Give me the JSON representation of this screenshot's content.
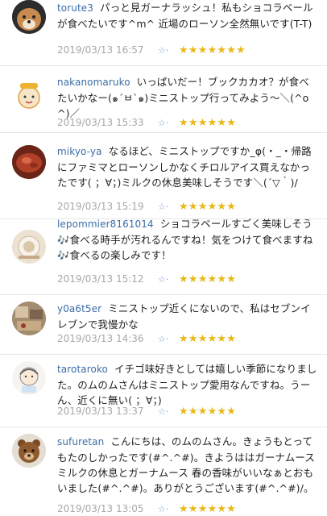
{
  "comments": [
    {
      "user": "torute3",
      "text": "パっと見ガーナラッシュ！私もショコラベールが食べたいです^m^ 近場のローソン全然無いです(T-T)",
      "date": "2019/03/13 16:57",
      "stars": "★★★★★★★",
      "mini_star": "☆·"
    },
    {
      "user": "nakanomaruko",
      "text": "いっぱいだー！ブックカカオ？が食べたいかなー(๑´ㅂ`๑)ミニストップ行ってみよう〜＼(^o^)／",
      "date": "2019/03/13 15:33",
      "stars": "★★★★★★",
      "mini_star": "☆·"
    },
    {
      "user": "mikyo-ya",
      "text": "なるほど、ミニストップですか_φ(・_・帰路にファミマとローソンしかなくチロルアイス買えなかったです( ；∀；)ミルクの休息美味しそうです＼(´▽｀)/",
      "date": "2019/03/13 15:19",
      "stars": "★★★★★★",
      "mini_star": "☆·"
    },
    {
      "user": "lepommier8161014",
      "text": "ショコラベールすごく美味しそう🎶食べる時手が汚れるんですね！気をつけて食べますね🎶食べるの楽しみです！",
      "date": "2019/03/13 15:12",
      "stars": "★★★★★★",
      "mini_star": "☆·"
    },
    {
      "user": "y0a6t5er",
      "text": "ミニストップ近くにないので、私はセブンイレブンで我慢かな",
      "date": "2019/03/13 14:36",
      "stars": "★★★★★★",
      "mini_star": "☆·"
    },
    {
      "user": "tarotaroko",
      "text": "イチゴ味好きとしては嬉しい季節になりました。のムのムさんはミニストップ愛用なんですね。うーん、近くに無い( ；∀；)",
      "date": "2019/03/13 13:37",
      "stars": "★★★★★★",
      "mini_star": "☆·"
    },
    {
      "user": "sufuretan",
      "text": "こんにちは、のムのムさん。きょうもとってもたのしかったです(#^.^#)。きようははガーナムース ミルクの休息とガーナムース 春の香味がいいなぁとおもいました(#^.^#)。ありがとうございます(#^.^#)/。",
      "date": "2019/03/13 13:05",
      "stars": "★★★★★★",
      "mini_star": "☆·"
    }
  ]
}
